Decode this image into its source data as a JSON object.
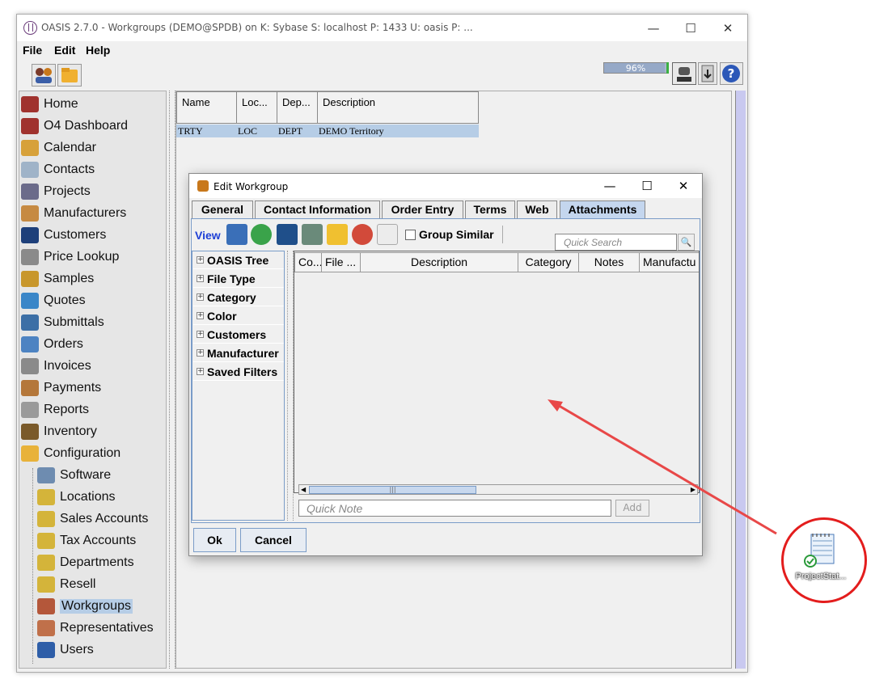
{
  "window": {
    "title": "OASIS 2.7.0 - Workgroups (DEMO@SPDB) on K: Sybase  S: localhost  P: 1433  U: oasis  P: ...",
    "minimize": "—",
    "maximize": "☐",
    "close": "✕"
  },
  "menu": [
    "File",
    "Edit",
    "Help"
  ],
  "status": {
    "progress_text": "96%",
    "progress_value": 96
  },
  "navigator": {
    "items": [
      {
        "label": "Home",
        "icon": "home-icon",
        "color": "#a0322e"
      },
      {
        "label": "O4 Dashboard",
        "icon": "dashboard-icon",
        "color": "#a0322e"
      },
      {
        "label": "Calendar",
        "icon": "calendar-icon",
        "color": "#d7a13a"
      },
      {
        "label": "Contacts",
        "icon": "contacts-icon",
        "color": "#9fb3c8"
      },
      {
        "label": "Projects",
        "icon": "projects-icon",
        "color": "#6b6b8a"
      },
      {
        "label": "Manufacturers",
        "icon": "manufacturers-icon",
        "color": "#c68a42"
      },
      {
        "label": "Customers",
        "icon": "customers-icon",
        "color": "#1d3f7a"
      },
      {
        "label": "Price Lookup",
        "icon": "price-lookup-icon",
        "color": "#8a8a8a"
      },
      {
        "label": "Samples",
        "icon": "samples-icon",
        "color": "#c8972c"
      },
      {
        "label": "Quotes",
        "icon": "quotes-icon",
        "color": "#3a86c8"
      },
      {
        "label": "Submittals",
        "icon": "submittals-icon",
        "color": "#3c6fa6"
      },
      {
        "label": "Orders",
        "icon": "orders-icon",
        "color": "#4d83c2"
      },
      {
        "label": "Invoices",
        "icon": "invoices-icon",
        "color": "#8a8a8a"
      },
      {
        "label": "Payments",
        "icon": "payments-icon",
        "color": "#b4773a"
      },
      {
        "label": "Reports",
        "icon": "reports-icon",
        "color": "#9a9a9a"
      },
      {
        "label": "Inventory",
        "icon": "inventory-icon",
        "color": "#7a5a2a"
      },
      {
        "label": "Configuration",
        "icon": "folder-icon",
        "color": "#e8b23a"
      },
      {
        "label": "Software",
        "icon": "software-icon",
        "color": "#6e8cb0",
        "child": true
      },
      {
        "label": "Locations",
        "icon": "locations-icon",
        "color": "#d4b43a",
        "child": true
      },
      {
        "label": "Sales Accounts",
        "icon": "sales-accounts-icon",
        "color": "#d4b43a",
        "child": true
      },
      {
        "label": "Tax Accounts",
        "icon": "tax-accounts-icon",
        "color": "#d4b43a",
        "child": true
      },
      {
        "label": "Departments",
        "icon": "departments-icon",
        "color": "#d4b43a",
        "child": true
      },
      {
        "label": "Resell",
        "icon": "resell-icon",
        "color": "#d4b43a",
        "child": true
      },
      {
        "label": "Workgroups",
        "icon": "workgroups-icon",
        "color": "#b4573a",
        "child": true,
        "selected": true
      },
      {
        "label": "Representatives",
        "icon": "representatives-icon",
        "color": "#c0704a",
        "child": true
      },
      {
        "label": "Users",
        "icon": "users-icon",
        "color": "#2e5ea8",
        "child": true
      }
    ]
  },
  "workgroups_table": {
    "headers": [
      "Name",
      "Loc...",
      "Dep...",
      "Description"
    ],
    "rows": [
      [
        "TRTY",
        "LOC",
        "DEPT",
        "DEMO Territory"
      ]
    ]
  },
  "dialog": {
    "title": "Edit Workgroup",
    "minimize": "—",
    "maximize": "☐",
    "close": "✕",
    "tabs": [
      "General",
      "Contact Information",
      "Order Entry",
      "Terms",
      "Web",
      "Attachments"
    ],
    "active_tab": "Attachments",
    "view_label": "View",
    "group_similar": "Group Similar",
    "quick_search_placeholder": "Quick Search",
    "search_icon": "🔍",
    "filters": [
      "OASIS Tree",
      "File Type",
      "Category",
      "Color",
      "Customers",
      "Manufacturer",
      "Saved Filters"
    ],
    "attachment_columns": [
      "Co...",
      "File ...",
      "Description",
      "Category",
      "Notes",
      "Manufactu"
    ],
    "quick_note_placeholder": "Quick Note",
    "add_label": "Add",
    "ok_label": "Ok",
    "cancel_label": "Cancel"
  },
  "desktop": {
    "icon_label": "ProjectStat..."
  }
}
